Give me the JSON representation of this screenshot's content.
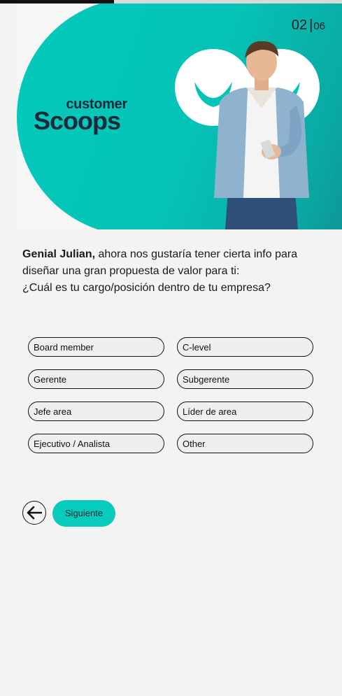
{
  "progress": {
    "step": 2,
    "total": 6,
    "fraction": 0.333
  },
  "hero": {
    "brand_small": "customer",
    "brand_big": "Scoops",
    "step_current": "02",
    "step_separator": "|",
    "step_total": "06"
  },
  "question": {
    "greeting": "Genial Julian,",
    "line1": " ahora nos gustaría tener cierta info para diseñar una gran propuesta de valor para ti:",
    "line2": "¿Cuál es tu cargo/posición dentro de tu empresa?"
  },
  "options": [
    "Board member",
    "C-level",
    "Gerente",
    "Subgerente",
    "Jefe area",
    "Líder de area",
    "Ejecutivo / Analista",
    "Other"
  ],
  "nav": {
    "back_icon": "arrow-left-icon",
    "next_label": "Siguiente"
  },
  "colors": {
    "accent": "#07cbbd",
    "brand_dark": "#1d2a3a",
    "background": "#f3f3f3"
  }
}
